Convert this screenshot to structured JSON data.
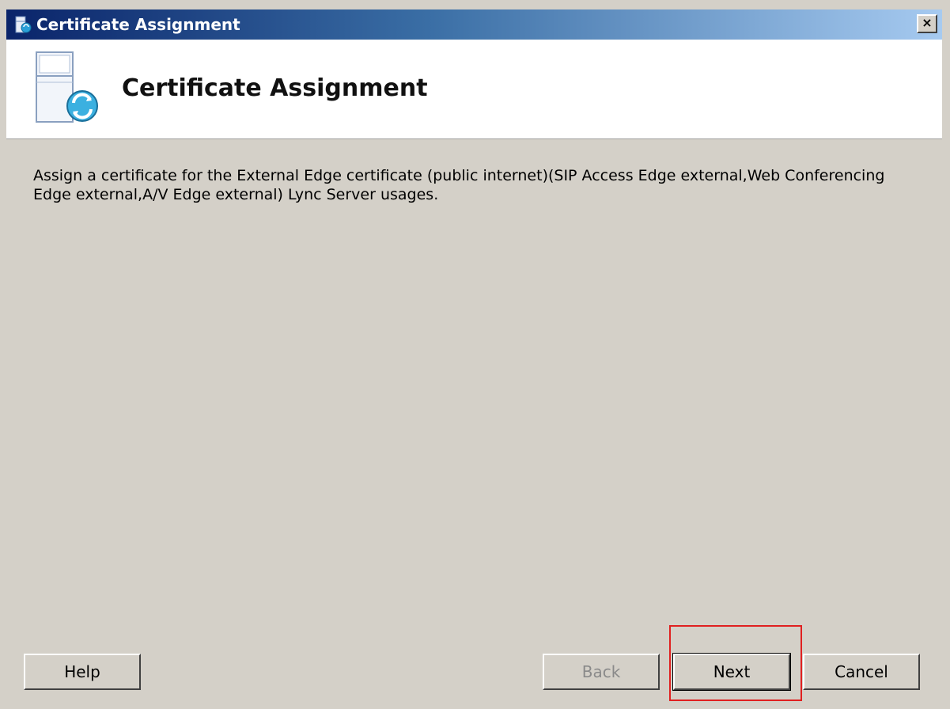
{
  "window": {
    "title": "Certificate Assignment",
    "close_label": "×"
  },
  "header": {
    "title": "Certificate Assignment",
    "icon": "server-sync-icon"
  },
  "main": {
    "description": "Assign a certificate for the External Edge certificate (public internet)(SIP Access Edge external,Web Conferencing Edge external,A/V Edge external) Lync Server usages."
  },
  "buttons": {
    "help": "Help",
    "back": "Back",
    "next": "Next",
    "cancel": "Cancel"
  },
  "colors": {
    "dialog_background": "#d4d0c8",
    "header_background": "#ffffff",
    "title_gradient_start": "#0a246a",
    "title_gradient_end": "#a6caf0",
    "highlight_border": "#e02020"
  }
}
